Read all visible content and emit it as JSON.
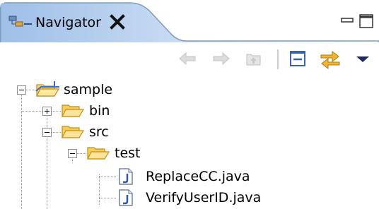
{
  "view": {
    "title": "Navigator",
    "title_icon": "navigator-view-icon",
    "close_icon": "close-icon",
    "minimize_icon": "minimize-icon",
    "maximize_icon": "maximize-icon"
  },
  "toolbar": {
    "buttons": [
      {
        "icon": "back-arrow-icon",
        "enabled": false
      },
      {
        "icon": "forward-arrow-icon",
        "enabled": false
      },
      {
        "icon": "up-folder-icon",
        "enabled": false
      },
      {
        "icon": "collapse-all-icon",
        "enabled": true
      },
      {
        "icon": "link-with-editor-icon",
        "enabled": true
      },
      {
        "icon": "view-menu-dropdown-icon",
        "enabled": true
      }
    ]
  },
  "tree": {
    "nodes": [
      {
        "label": "sample",
        "icon": "project-folder-icon",
        "expander": "collapse"
      },
      {
        "label": "bin",
        "icon": "folder-icon",
        "expander": "expand"
      },
      {
        "label": "src",
        "icon": "folder-icon",
        "expander": "collapse"
      },
      {
        "label": "test",
        "icon": "folder-icon",
        "expander": "collapse"
      },
      {
        "label": "ReplaceCC.java",
        "icon": "java-file-icon",
        "expander": "none"
      },
      {
        "label": "VerifyUserID.java",
        "icon": "java-file-icon",
        "expander": "none"
      }
    ]
  },
  "colors": {
    "tab_gradient_start": "#9fbfe8",
    "tab_gradient_end": "#ffffff",
    "border": "#7f9db9",
    "folder_yellow": "#f6d36b",
    "folder_outline": "#c98a10",
    "arrow_orange": "#e8a21a",
    "disabled_gray": "#c4c4c4"
  }
}
